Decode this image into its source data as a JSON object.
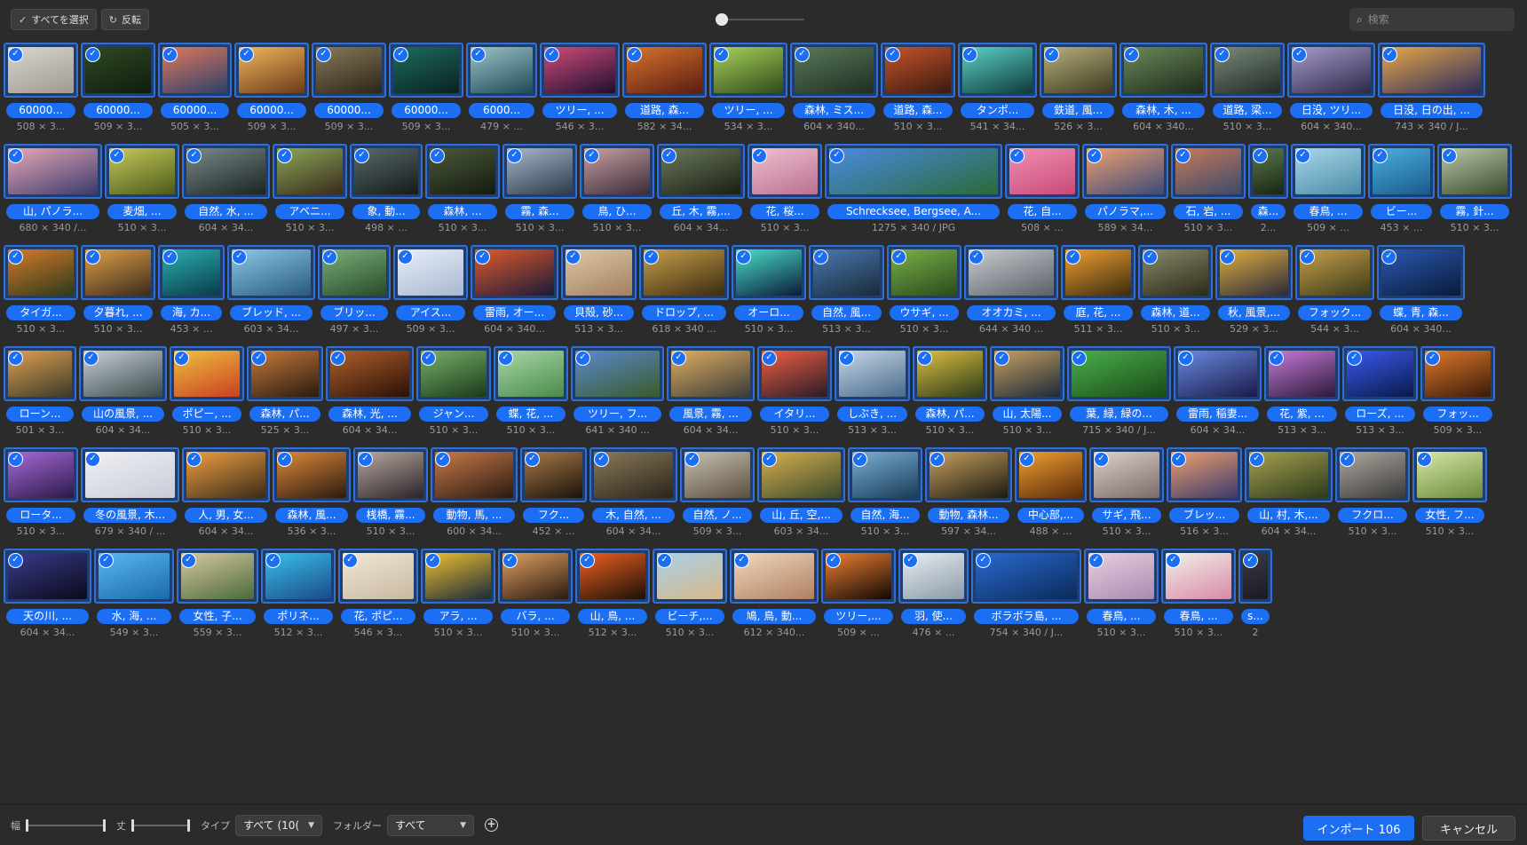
{
  "toolbar": {
    "select_all_label": "すべてを選択",
    "invert_label": "反転",
    "search_placeholder": "検索"
  },
  "rows": [
    [
      {
        "name": "60000...",
        "meta": "508 × 3...",
        "w": 84,
        "c1": "#d9d6cf",
        "c2": "#9e9a90"
      },
      {
        "name": "60000...",
        "meta": "509 × 3...",
        "w": 84,
        "c1": "#2f4a22",
        "c2": "#0f1c0e"
      },
      {
        "name": "60000...",
        "meta": "505 × 3...",
        "w": 83,
        "c1": "#e07a5c",
        "c2": "#2c3f6a"
      },
      {
        "name": "60000...",
        "meta": "509 × 3...",
        "w": 84,
        "c1": "#f3b75c",
        "c2": "#6a3a18"
      },
      {
        "name": "60000...",
        "meta": "509 × 3...",
        "w": 84,
        "c1": "#8a7a5a",
        "c2": "#2b2418"
      },
      {
        "name": "60000...",
        "meta": "509 × 3...",
        "w": 84,
        "c1": "#1f6b5e",
        "c2": "#08221f"
      },
      {
        "name": "6000...",
        "meta": "479 × ...",
        "w": 80,
        "c1": "#9ec3c7",
        "c2": "#1c4a58"
      },
      {
        "name": "ツリー, ...",
        "meta": "546 × 3...",
        "w": 90,
        "c1": "#d24a7a",
        "c2": "#1d1030"
      },
      {
        "name": "道路, 森...",
        "meta": "582 × 34...",
        "w": 95,
        "c1": "#d8742e",
        "c2": "#5a1c10"
      },
      {
        "name": "ツリー, ...",
        "meta": "534 × 3...",
        "w": 88,
        "c1": "#a8d25a",
        "c2": "#2f4a1c"
      },
      {
        "name": "森林, ミス...",
        "meta": "604 × 340...",
        "w": 99,
        "c1": "#5a7a5a",
        "c2": "#1e2e22"
      },
      {
        "name": "道路, 森...",
        "meta": "510 × 3...",
        "w": 84,
        "c1": "#c8542a",
        "c2": "#3a1a10"
      },
      {
        "name": "タンポ...",
        "meta": "541 × 34...",
        "w": 89,
        "c1": "#5ad2c7",
        "c2": "#0f3a3a"
      },
      {
        "name": "鉄道, 風...",
        "meta": "526 × 3...",
        "w": 87,
        "c1": "#b8b07a",
        "c2": "#3a3a22"
      },
      {
        "name": "森林, 木, ...",
        "meta": "604 × 340...",
        "w": 99,
        "c1": "#6a8a5a",
        "c2": "#1e2a1a"
      },
      {
        "name": "道路, 梁...",
        "meta": "510 × 3...",
        "w": 84,
        "c1": "#7a8a7a",
        "c2": "#202a26"
      },
      {
        "name": "日没, ツリ...",
        "meta": "604 × 340...",
        "w": 99,
        "c1": "#a89ac8",
        "c2": "#2a2a4a"
      },
      {
        "name": "日没, 日の出, ...",
        "meta": "743 × 340 / J...",
        "w": 121,
        "c1": "#e8a84a",
        "c2": "#2a2a5a"
      }
    ],
    [
      {
        "name": "山, パノラ...",
        "meta": "680 × 340 /...",
        "w": 111,
        "c1": "#e8a8b8",
        "c2": "#3a3a6a"
      },
      {
        "name": "麦畑, ...",
        "meta": "510 × 3...",
        "w": 84,
        "c1": "#c8c85a",
        "c2": "#4a5a1a"
      },
      {
        "name": "自然, 水, ...",
        "meta": "604 × 34...",
        "w": 99,
        "c1": "#7a8a8a",
        "c2": "#1a2422"
      },
      {
        "name": "アベニ...",
        "meta": "510 × 3...",
        "w": 84,
        "c1": "#8aa85a",
        "c2": "#3a2a1a"
      },
      {
        "name": "象, 動...",
        "meta": "498 × ...",
        "w": 82,
        "c1": "#5a6a6a",
        "c2": "#141a1a"
      },
      {
        "name": "森林, ...",
        "meta": "510 × 3...",
        "w": 84,
        "c1": "#4a5a3a",
        "c2": "#141a10"
      },
      {
        "name": "霧, 森...",
        "meta": "510 × 3...",
        "w": 84,
        "c1": "#a8b8c8",
        "c2": "#2a3a4a"
      },
      {
        "name": "鳥, ひ...",
        "meta": "510 × 3...",
        "w": 84,
        "c1": "#c8a0a0",
        "c2": "#3a2a3a"
      },
      {
        "name": "丘, 木, 霧,...",
        "meta": "604 × 34...",
        "w": 99,
        "c1": "#6a7a5a",
        "c2": "#1a1e14"
      },
      {
        "name": "花, 桜...",
        "meta": "510 × 3...",
        "w": 84,
        "c1": "#f0c0d0",
        "c2": "#b87090"
      },
      {
        "name": "Schrecksee, Bergsee, A...",
        "meta": "1275 × 340 / JPG",
        "w": 200,
        "c1": "#4a8ae0",
        "c2": "#2a6a3a"
      },
      {
        "name": "花, 自...",
        "meta": "508 × ...",
        "w": 84,
        "c1": "#f090b0",
        "c2": "#c84a7a"
      },
      {
        "name": "パノラマ,...",
        "meta": "589 × 34...",
        "w": 97,
        "c1": "#f0a070",
        "c2": "#3a4a7a"
      },
      {
        "name": "石, 岩, ...",
        "meta": "510 × 3...",
        "w": 84,
        "c1": "#c87a5a",
        "c2": "#3a4a6a"
      },
      {
        "name": "森...",
        "meta": "2...",
        "w": 45,
        "c1": "#5a7a4a",
        "c2": "#1a2414"
      },
      {
        "name": "春鳥, ...",
        "meta": "509 × ...",
        "w": 84,
        "c1": "#a8d8e8",
        "c2": "#4a8aa8"
      },
      {
        "name": "ビー...",
        "meta": "453 × ...",
        "w": 75,
        "c1": "#4ab0e0",
        "c2": "#1a5a8a"
      },
      {
        "name": "霧, 針...",
        "meta": "510 × 3...",
        "w": 84,
        "c1": "#b8c8a8",
        "c2": "#3a4a2a"
      }
    ],
    [
      {
        "name": "タイガ...",
        "meta": "510 × 3...",
        "w": 84,
        "c1": "#d87a2a",
        "c2": "#2a3a1a"
      },
      {
        "name": "夕暮れ, ...",
        "meta": "510 × 3...",
        "w": 84,
        "c1": "#e0a04a",
        "c2": "#3a2a1a"
      },
      {
        "name": "海, カ...",
        "meta": "453 × ...",
        "w": 75,
        "c1": "#2ab0b0",
        "c2": "#0a3a4a"
      },
      {
        "name": "ブレッド, ...",
        "meta": "603 × 34...",
        "w": 99,
        "c1": "#8ac8e8",
        "c2": "#2a5a7a"
      },
      {
        "name": "ブリッ...",
        "meta": "497 × 3...",
        "w": 82,
        "c1": "#7ab07a",
        "c2": "#2a4a2a"
      },
      {
        "name": "アイス...",
        "meta": "509 × 3...",
        "w": 84,
        "c1": "#e8eef8",
        "c2": "#a8b8d0"
      },
      {
        "name": "雷雨, オー...",
        "meta": "604 × 340...",
        "w": 99,
        "c1": "#e05a2a",
        "c2": "#1a1a3a"
      },
      {
        "name": "貝殻, 砂...",
        "meta": "513 × 3...",
        "w": 85,
        "c1": "#e0c8a8",
        "c2": "#a08060"
      },
      {
        "name": "ドロップ, ...",
        "meta": "618 × 340 ...",
        "w": 101,
        "c1": "#c8a04a",
        "c2": "#3a2a10"
      },
      {
        "name": "オーロ...",
        "meta": "510 × 3...",
        "w": 84,
        "c1": "#4ae0c8",
        "c2": "#0a1a3a"
      },
      {
        "name": "自然, 風...",
        "meta": "513 × 3...",
        "w": 85,
        "c1": "#4a7ab0",
        "c2": "#1a2a3a"
      },
      {
        "name": "ウサギ, ...",
        "meta": "510 × 3...",
        "w": 84,
        "c1": "#7ab04a",
        "c2": "#2a4a1a"
      },
      {
        "name": "オオカミ, ...",
        "meta": "644 × 340 ...",
        "w": 106,
        "c1": "#c8ccd0",
        "c2": "#5a6068"
      },
      {
        "name": "庭, 花, ...",
        "meta": "511 × 3...",
        "w": 84,
        "c1": "#f0a030",
        "c2": "#3a2a10"
      },
      {
        "name": "森林, 道...",
        "meta": "510 × 3...",
        "w": 84,
        "c1": "#8a8a6a",
        "c2": "#2a2a1a"
      },
      {
        "name": "秋, 風景,...",
        "meta": "529 × 3...",
        "w": 87,
        "c1": "#e0b040",
        "c2": "#2a2a3a"
      },
      {
        "name": "フォック...",
        "meta": "544 × 3...",
        "w": 89,
        "c1": "#c8a04a",
        "c2": "#3a3a1a"
      },
      {
        "name": "蝶, 青, 森...",
        "meta": "604 × 340...",
        "w": 99,
        "c1": "#2a5ab0",
        "c2": "#0a1a3a"
      }
    ],
    [
      {
        "name": "ローン...",
        "meta": "501 × 3...",
        "w": 82,
        "c1": "#e0a050",
        "c2": "#3a3a2a"
      },
      {
        "name": "山の風景, ...",
        "meta": "604 × 34...",
        "w": 99,
        "c1": "#c8d0d8",
        "c2": "#3a4a4a"
      },
      {
        "name": "ポピー, ...",
        "meta": "510 × 3...",
        "w": 84,
        "c1": "#f0c040",
        "c2": "#c84020"
      },
      {
        "name": "森林, パ...",
        "meta": "525 × 3...",
        "w": 86,
        "c1": "#c87a3a",
        "c2": "#2a1a10"
      },
      {
        "name": "森林, 光, ...",
        "meta": "604 × 34...",
        "w": 99,
        "c1": "#b0602a",
        "c2": "#2a1008"
      },
      {
        "name": "ジャン...",
        "meta": "510 × 3...",
        "w": 84,
        "c1": "#7ab06a",
        "c2": "#1a3a1a"
      },
      {
        "name": "蝶, 花, ...",
        "meta": "510 × 3...",
        "w": 84,
        "c1": "#a8d8a8",
        "c2": "#4a8a4a"
      },
      {
        "name": "ツリー, フ...",
        "meta": "641 × 340 ...",
        "w": 105,
        "c1": "#5a8ad0",
        "c2": "#3a5a2a"
      },
      {
        "name": "風景, 霧, ...",
        "meta": "604 × 34...",
        "w": 99,
        "c1": "#e0b060",
        "c2": "#3a3a3a"
      },
      {
        "name": "イタリ...",
        "meta": "510 × 3...",
        "w": 84,
        "c1": "#f06040",
        "c2": "#2a1a2a"
      },
      {
        "name": "しぶき, ...",
        "meta": "513 × 3...",
        "w": 85,
        "c1": "#c8d8e8",
        "c2": "#4a6a8a"
      },
      {
        "name": "森林, パ...",
        "meta": "510 × 3...",
        "w": 84,
        "c1": "#e0c040",
        "c2": "#2a3a1a"
      },
      {
        "name": "山, 太陽...",
        "meta": "510 × 3...",
        "w": 84,
        "c1": "#c8a060",
        "c2": "#1a2a3a"
      },
      {
        "name": "葉, 緑, 緑の...",
        "meta": "715 × 340 / J...",
        "w": 117,
        "c1": "#4ab04a",
        "c2": "#1a4a1a"
      },
      {
        "name": "雷雨, 稲妻...",
        "meta": "604 × 34...",
        "w": 99,
        "c1": "#6a8ae0",
        "c2": "#1a1a4a"
      },
      {
        "name": "花, 紫, ...",
        "meta": "513 × 3...",
        "w": 85,
        "c1": "#c87ad8",
        "c2": "#2a1a3a"
      },
      {
        "name": "ローズ, ...",
        "meta": "513 × 3...",
        "w": 85,
        "c1": "#3a5af0",
        "c2": "#0a1a4a"
      },
      {
        "name": "フォッ...",
        "meta": "509 × 3...",
        "w": 84,
        "c1": "#e07a2a",
        "c2": "#3a1a0a"
      }
    ],
    [
      {
        "name": "ロータ...",
        "meta": "510 × 3...",
        "w": 84,
        "c1": "#a86ad8",
        "c2": "#2a1a4a"
      },
      {
        "name": "冬の風景, 木...",
        "meta": "679 × 340 / ...",
        "w": 111,
        "c1": "#f0f0f4",
        "c2": "#c8ccd8"
      },
      {
        "name": "人, 男, 女...",
        "meta": "604 × 34...",
        "w": 99,
        "c1": "#f0a040",
        "c2": "#3a2a1a"
      },
      {
        "name": "森林, 風...",
        "meta": "536 × 3...",
        "w": 88,
        "c1": "#e08a3a",
        "c2": "#2a1a10"
      },
      {
        "name": "桟橋, 霧...",
        "meta": "510 × 3...",
        "w": 84,
        "c1": "#b8a8a0",
        "c2": "#2a2428"
      },
      {
        "name": "動物, 馬, ...",
        "meta": "600 × 34...",
        "w": 98,
        "c1": "#c87a4a",
        "c2": "#2a1a10"
      },
      {
        "name": "フク...",
        "meta": "452 × ...",
        "w": 75,
        "c1": "#a87a4a",
        "c2": "#1a1208"
      },
      {
        "name": "木, 自然, ...",
        "meta": "604 × 34...",
        "w": 99,
        "c1": "#8a7a5a",
        "c2": "#2a241a"
      },
      {
        "name": "自然, ノ...",
        "meta": "509 × 3...",
        "w": 84,
        "c1": "#c8c0b0",
        "c2": "#5a5040"
      },
      {
        "name": "山, 丘, 空,...",
        "meta": "603 × 34...",
        "w": 99,
        "c1": "#d8b050",
        "c2": "#3a4a2a"
      },
      {
        "name": "自然, 海...",
        "meta": "510 × 3...",
        "w": 84,
        "c1": "#7ab0d0",
        "c2": "#1a3a5a"
      },
      {
        "name": "動物, 森林...",
        "meta": "597 × 34...",
        "w": 98,
        "c1": "#c8a060",
        "c2": "#1a1a10"
      },
      {
        "name": "中心部,...",
        "meta": "488 × ...",
        "w": 81,
        "c1": "#f0a030",
        "c2": "#5a2a0a"
      },
      {
        "name": "サギ, 飛...",
        "meta": "510 × 3...",
        "w": 84,
        "c1": "#e0d0c8",
        "c2": "#7a6a6a"
      },
      {
        "name": "ブレッ...",
        "meta": "516 × 3...",
        "w": 85,
        "c1": "#f0a070",
        "c2": "#3a3a6a"
      },
      {
        "name": "山, 村, 木,...",
        "meta": "604 × 34...",
        "w": 99,
        "c1": "#a8a050",
        "c2": "#2a3a1a"
      },
      {
        "name": "フクロ...",
        "meta": "510 × 3...",
        "w": 84,
        "c1": "#b0a8a0",
        "c2": "#3a3a3a"
      },
      {
        "name": "女性, フ...",
        "meta": "510 × 3...",
        "w": 84,
        "c1": "#d8e8a8",
        "c2": "#6a8a3a"
      }
    ],
    [
      {
        "name": "天の川, ...",
        "meta": "604 × 34...",
        "w": 99,
        "c1": "#3a3a8a",
        "c2": "#0a0a1a"
      },
      {
        "name": "水, 海, ...",
        "meta": "549 × 3...",
        "w": 90,
        "c1": "#5ab8f0",
        "c2": "#1a6aa8"
      },
      {
        "name": "女性, 子...",
        "meta": "559 × 3...",
        "w": 92,
        "c1": "#d8c8a0",
        "c2": "#4a6a3a"
      },
      {
        "name": "ポリネ...",
        "meta": "512 × 3...",
        "w": 84,
        "c1": "#3ac0e8",
        "c2": "#1a4a8a"
      },
      {
        "name": "花, ポピ...",
        "meta": "546 × 3...",
        "w": 90,
        "c1": "#f0e8d8",
        "c2": "#c8b8a0"
      },
      {
        "name": "アラ, ...",
        "meta": "510 × 3...",
        "w": 84,
        "c1": "#f0c030",
        "c2": "#1a2a3a"
      },
      {
        "name": "バラ, ...",
        "meta": "510 × 3...",
        "w": 84,
        "c1": "#e0a060",
        "c2": "#2a1a10"
      },
      {
        "name": "山, 鳥, ...",
        "meta": "512 × 3...",
        "w": 84,
        "c1": "#f06020",
        "c2": "#1a1008"
      },
      {
        "name": "ビーチ,...",
        "meta": "510 × 3...",
        "w": 84,
        "c1": "#a8d0e8",
        "c2": "#d8b88a"
      },
      {
        "name": "鳩, 鳥, 動...",
        "meta": "612 × 340...",
        "w": 100,
        "c1": "#f0d8c0",
        "c2": "#b08060"
      },
      {
        "name": "ツリー,...",
        "meta": "509 × ...",
        "w": 84,
        "c1": "#f08030",
        "c2": "#100806"
      },
      {
        "name": "羽, 使...",
        "meta": "476 × ...",
        "w": 79,
        "c1": "#e8ecf0",
        "c2": "#8a9aa8"
      },
      {
        "name": "ボラボラ島, ...",
        "meta": "754 × 340 / J...",
        "w": 124,
        "c1": "#2a6ad0",
        "c2": "#0a2a5a"
      },
      {
        "name": "春鳥, ...",
        "meta": "510 × 3...",
        "w": 84,
        "c1": "#e8d0e0",
        "c2": "#a88ab0"
      },
      {
        "name": "春鳥, ...",
        "meta": "510 × 3...",
        "w": 84,
        "c1": "#f0f0e8",
        "c2": "#d88aa8"
      },
      {
        "name": "s...",
        "meta": "2",
        "w": 38,
        "c1": "#3a3a44",
        "c2": "#1a1a22"
      }
    ]
  ],
  "bottombar": {
    "width_label": "幅",
    "height_label": "丈",
    "type_label": "タイプ",
    "type_value": "すべて (10(",
    "folder_label": "フォルダー",
    "folder_value": "すべて",
    "import_label": "インポート 106",
    "cancel_label": "キャンセル"
  }
}
